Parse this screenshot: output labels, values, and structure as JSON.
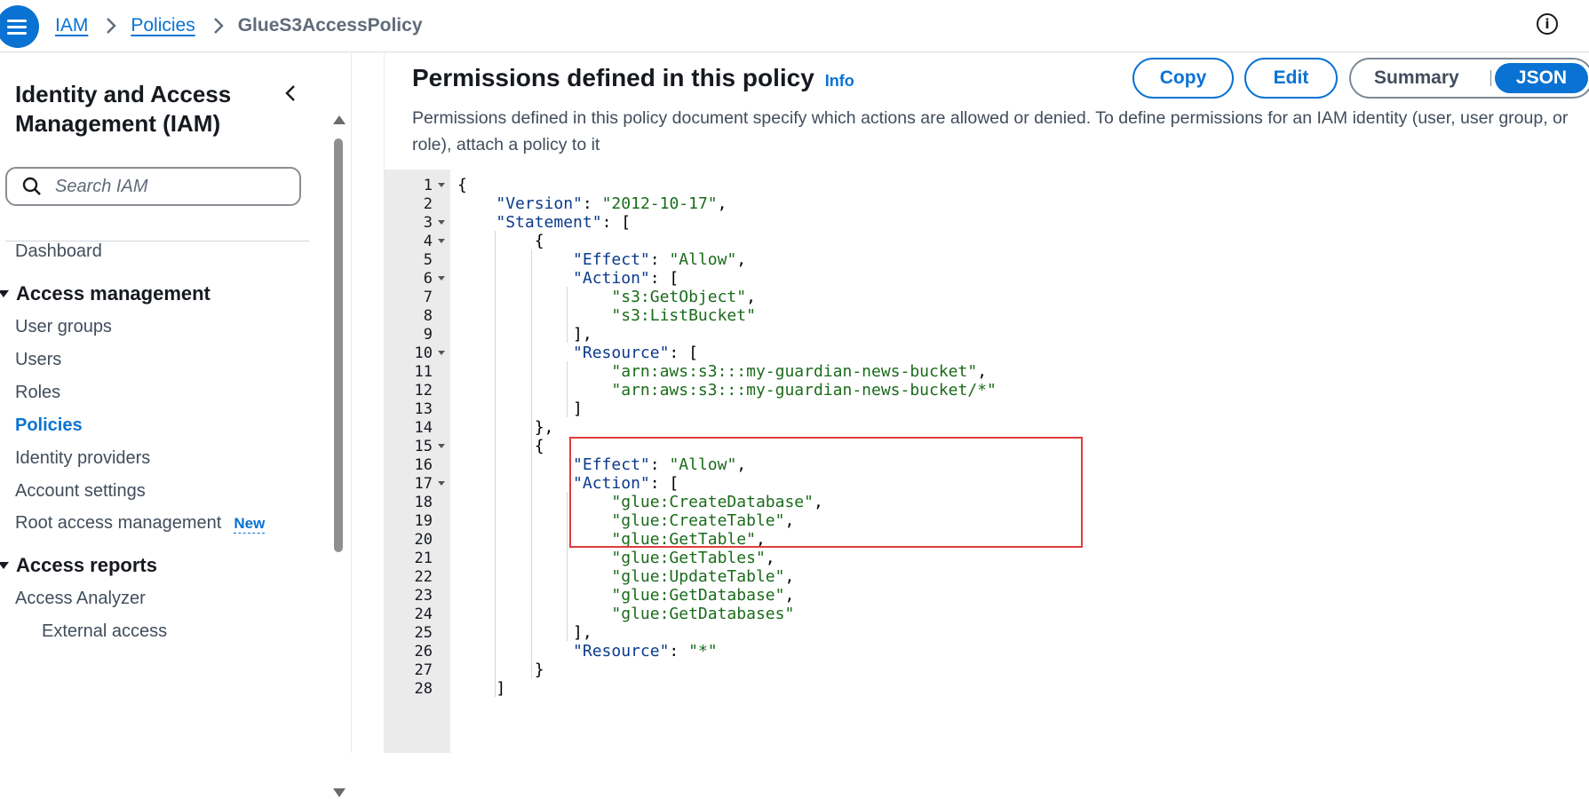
{
  "breadcrumb": {
    "root": "IAM",
    "section": "Policies",
    "current": "GlueS3AccessPolicy"
  },
  "sidebar": {
    "title": "Identity and Access Management (IAM)",
    "search_placeholder": "Search IAM",
    "dashboard": "Dashboard",
    "access_management": {
      "label": "Access management",
      "items": [
        "User groups",
        "Users",
        "Roles",
        "Policies",
        "Identity providers",
        "Account settings",
        "Root access management"
      ],
      "new_badge": "New"
    },
    "access_reports": {
      "label": "Access reports",
      "items": [
        "Access Analyzer",
        "External access"
      ]
    }
  },
  "main": {
    "title": "Permissions defined in this policy",
    "info": "Info",
    "copy_label": "Copy",
    "edit_label": "Edit",
    "summary_label": "Summary",
    "json_label": "JSON",
    "description": "Permissions defined in this policy document specify which actions are allowed or denied. To define permissions for an IAM identity (user, user group, or role), attach a policy to it"
  },
  "editor": {
    "lines": [
      "{",
      "    \"Version\": \"2012-10-17\",",
      "    \"Statement\": [",
      "        {",
      "            \"Effect\": \"Allow\",",
      "            \"Action\": [",
      "                \"s3:GetObject\",",
      "                \"s3:ListBucket\"",
      "            ],",
      "            \"Resource\": [",
      "                \"arn:aws:s3:::my-guardian-news-bucket\",",
      "                \"arn:aws:s3:::my-guardian-news-bucket/*\"",
      "            ]",
      "        },",
      "        {",
      "            \"Effect\": \"Allow\",",
      "            \"Action\": [",
      "                \"glue:CreateDatabase\",",
      "                \"glue:CreateTable\",",
      "                \"glue:GetTable\",",
      "                \"glue:GetTables\",",
      "                \"glue:UpdateTable\",",
      "                \"glue:GetDatabase\",",
      "                \"glue:GetDatabases\"",
      "            ],",
      "            \"Resource\": \"*\"",
      "        }",
      "    ]"
    ],
    "foldable_lines": [
      1,
      3,
      4,
      6,
      10,
      15,
      17
    ]
  },
  "colors": {
    "accent": "#0972d3",
    "highlight_box": "#e03c3c",
    "json_key": "#0b3a8c",
    "json_string": "#1a6b1a"
  }
}
